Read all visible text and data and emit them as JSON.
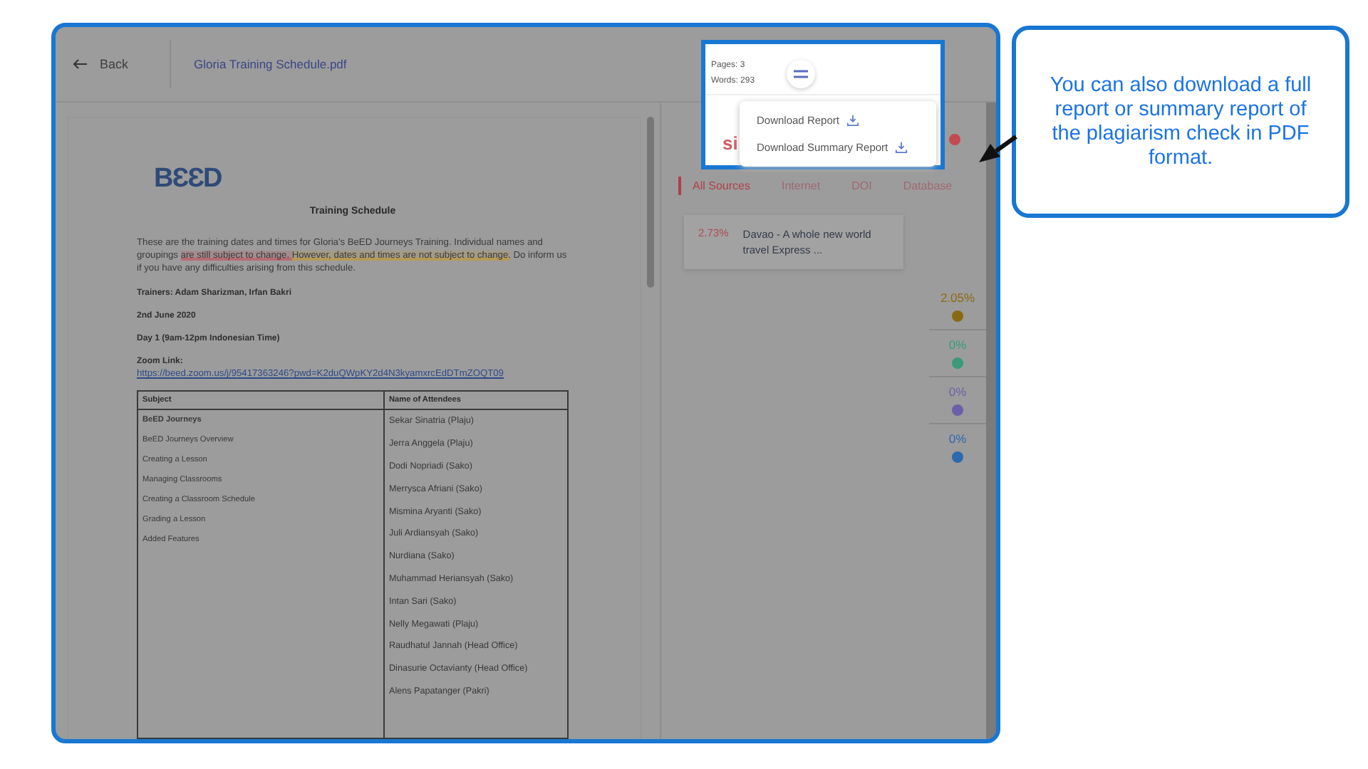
{
  "header": {
    "back": "Back",
    "file_name": "Gloria Training Schedule.pdf"
  },
  "document": {
    "logo": "BƐƐD",
    "title": "Training Schedule",
    "intro": [
      {
        "kind": "plain",
        "text": "These are the training dates and times for Gloria's BeED Journeys Training. Individual names and groupings "
      },
      {
        "kind": "match",
        "color": "#b86a72",
        "text": "are still subject to change. "
      },
      {
        "kind": "match",
        "color": "#b89a55",
        "text": "However, dates and times are not subject to change."
      },
      {
        "kind": "plain",
        "text": " Do inform us if you have any difficulties arising from this schedule."
      }
    ],
    "lines": [
      "Trainers: Adam Sharizman, Irfan Bakri",
      "2nd June 2020",
      "Day 1 (9am-12pm Indonesian Time)"
    ],
    "zoom_label": "Zoom Link:",
    "zoom_link": "https://beed.zoom.us/j/95417363246?pwd=K2duQWpKY2d4N3kyamxrcEdDTmZOQT09",
    "table": {
      "columns": [
        "Subject",
        "Name of Attendees"
      ],
      "subjects": [
        {
          "kind": "heading",
          "text": "BeED Journeys"
        },
        {
          "kind": "item",
          "text": "BeED Journeys Overview"
        },
        {
          "kind": "item",
          "text": "Creating a Lesson"
        },
        {
          "kind": "item",
          "text": "Managing Classrooms"
        },
        {
          "kind": "item",
          "text": "Creating a Classroom Schedule"
        },
        {
          "kind": "item",
          "text": "Grading a Lesson"
        },
        {
          "kind": "item",
          "text": "Added Features"
        }
      ],
      "attendees": [
        "Sekar Sinatria (Plaju)",
        "Jerra Anggela (Plaju)",
        "Dodi Nopriadi (Sako)",
        "Merrysca Afriani (Sako)",
        "Mismina Aryanti (Sako)",
        "Juli Ardiansyah (Sako)",
        "Nurdiana (Sako)",
        "Muhammad Heriansyah (Sako)",
        "Intan Sari (Sako)",
        "Nelly Megawati (Plaju)",
        "Raudhatul Jannah (Head Office)",
        "Dinasurie Octavianty (Head Office)",
        "Alens Papatanger (Pakri)"
      ]
    }
  },
  "popup": {
    "pages": "Pages: 3",
    "words": "Words: 293",
    "score_text": "si",
    "menu": [
      "Download Report",
      "Download Summary Report"
    ]
  },
  "tabs": [
    {
      "label": "All Sources",
      "selected": true
    },
    {
      "label": "Internet",
      "selected": false
    },
    {
      "label": "DOI",
      "selected": false
    },
    {
      "label": "Database",
      "selected": false
    }
  ],
  "sources": [
    {
      "percent": "2.73%",
      "title": "Davao - A whole new world travel Express ..."
    }
  ],
  "stats": [
    {
      "value": "2.05%",
      "color": "#8a6a10"
    },
    {
      "value": "0%",
      "color": "#3a9a7a"
    },
    {
      "value": "0%",
      "color": "#6a5fa8"
    },
    {
      "value": "0%",
      "color": "#2a6aad"
    }
  ],
  "callout": "You can also download a full report or summary report of the plagiarism check in PDF format."
}
